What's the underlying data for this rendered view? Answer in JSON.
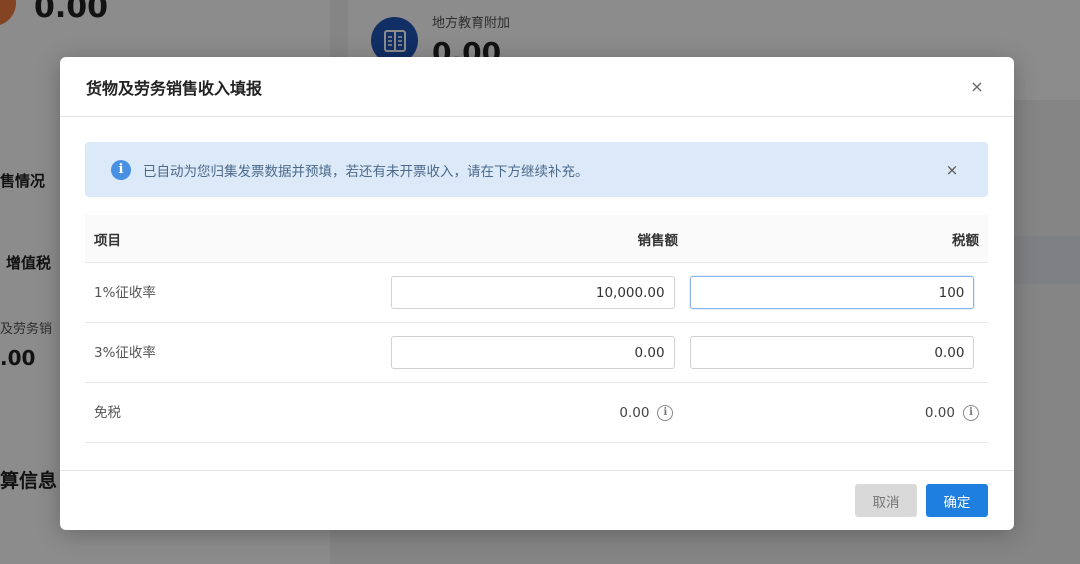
{
  "background": {
    "top_value": "0.00",
    "right_label": "地方教育附加",
    "right_value": "0.00",
    "side_label_1": "售情况",
    "side_label_2": "增值税",
    "side_label_3": "及劳务销",
    "side_value": ".00",
    "side_label_5": "算信息"
  },
  "modal": {
    "title": "货物及劳务销售收入填报",
    "close_icon": "×",
    "alert": {
      "icon": "i",
      "text": "已自动为您归集发票数据并预填，若还有未开票收入，请在下方继续补充。",
      "close_icon": "×"
    },
    "table": {
      "headers": {
        "item": "项目",
        "sales": "销售额",
        "tax": "税额"
      },
      "rows": [
        {
          "item": "1%征收率",
          "sales": "10,000.00",
          "tax": "100"
        },
        {
          "item": "3%征收率",
          "sales": "0.00",
          "tax": "0.00"
        },
        {
          "item": "免税",
          "sales": "0.00",
          "tax": "0.00"
        }
      ],
      "info_icon": "i"
    },
    "buttons": {
      "cancel": "取消",
      "ok": "确定"
    }
  },
  "colors": {
    "primary": "#1e7fe0",
    "alert_bg": "#dbe9f8",
    "accent_orange": "#f07b3f",
    "icon_blue": "#1f56b8"
  }
}
